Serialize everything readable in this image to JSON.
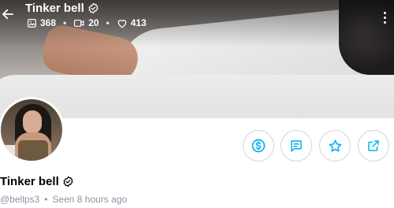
{
  "profile": {
    "display_name": "Tinker bell",
    "username": "@bellps3",
    "seen": "Seen 8 hours ago"
  },
  "stats": {
    "photos": "368",
    "videos": "20",
    "likes": "413"
  },
  "icons": {
    "back": "arrow-left-icon",
    "verified": "verified-badge-icon",
    "photos": "image-icon",
    "videos": "video-icon",
    "likes": "heart-icon",
    "more": "more-vertical-icon",
    "tip": "dollar-icon",
    "message": "message-icon",
    "favorite": "star-icon",
    "share": "share-icon"
  },
  "colors": {
    "accent": "#00aff0",
    "muted": "#8a96a3",
    "border": "#cfd6de"
  },
  "separator": "•"
}
